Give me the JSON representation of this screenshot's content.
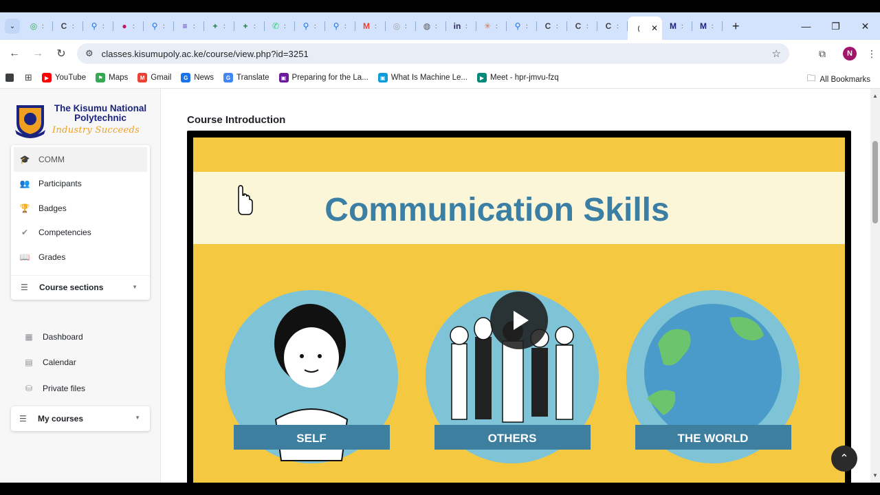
{
  "browser": {
    "tab_search_icon": "chevron-down-icon",
    "tabs": [
      {
        "icon": "google-lens-icon",
        "color": "#34a853",
        "glyph": "◎"
      },
      {
        "icon": "loading-c-icon",
        "color": "#444444",
        "glyph": "C"
      },
      {
        "icon": "search-icon",
        "color": "#1a73e8",
        "glyph": "⚲"
      },
      {
        "icon": "profile-icon",
        "color": "#c2185b",
        "glyph": "●"
      },
      {
        "icon": "search-icon",
        "color": "#1a73e8",
        "glyph": "⚲"
      },
      {
        "icon": "forms-icon",
        "color": "#5e35b1",
        "glyph": "≡"
      },
      {
        "icon": "sheets-icon",
        "color": "#188038",
        "glyph": "+"
      },
      {
        "icon": "sheets-icon",
        "color": "#188038",
        "glyph": "+"
      },
      {
        "icon": "whatsapp-icon",
        "color": "#25d366",
        "glyph": "✆"
      },
      {
        "icon": "search-icon",
        "color": "#1a73e8",
        "glyph": "⚲"
      },
      {
        "icon": "search-icon",
        "color": "#1a73e8",
        "glyph": "⚲"
      },
      {
        "icon": "gmail-icon",
        "color": "#ea4335",
        "glyph": "M"
      },
      {
        "icon": "spiral-icon",
        "color": "#9e9e9e",
        "glyph": "◎"
      },
      {
        "icon": "globe-icon",
        "color": "#555555",
        "glyph": "◍"
      },
      {
        "icon": "indeed-icon",
        "color": "#2d2d5f",
        "glyph": "in"
      },
      {
        "icon": "claude-icon",
        "color": "#d9774a",
        "glyph": "✳"
      },
      {
        "icon": "search-icon",
        "color": "#1a73e8",
        "glyph": "⚲"
      },
      {
        "icon": "loading-c-icon",
        "color": "#444444",
        "glyph": "C"
      },
      {
        "icon": "loading-c-icon",
        "color": "#444444",
        "glyph": "C"
      },
      {
        "icon": "loading-c-icon",
        "color": "#444444",
        "glyph": "C"
      }
    ],
    "active_tab_close": "✕",
    "extra_tabs": [
      {
        "icon": "moodle-m-icon",
        "color": "#1a237e",
        "glyph": "M"
      },
      {
        "icon": "moodle-m-icon",
        "color": "#1a237e",
        "glyph": "M"
      }
    ],
    "new_tab": "+",
    "window_controls": [
      "—",
      "❐",
      "✕"
    ],
    "url": "classes.kisumupoly.ac.ke/course/view.php?id=3251",
    "profile_initial": "N",
    "bookmarks": [
      {
        "label": "YouTube",
        "color": "#ff0000",
        "glyph": "▶"
      },
      {
        "label": "Maps",
        "color": "#34a853",
        "glyph": "⚑"
      },
      {
        "label": "Gmail",
        "color": "#ea4335",
        "glyph": "M"
      },
      {
        "label": "News",
        "color": "#1a73e8",
        "glyph": "G"
      },
      {
        "label": "Translate",
        "color": "#4285f4",
        "glyph": "G"
      },
      {
        "label": "Preparing for the La...",
        "color": "#6a1b9a",
        "glyph": "▣"
      },
      {
        "label": "What Is Machine Le...",
        "color": "#0f9bd7",
        "glyph": "▣"
      },
      {
        "label": "Meet - hpr-jmvu-fzq",
        "color": "#00897b",
        "glyph": "▶"
      }
    ],
    "all_bookmarks": "All Bookmarks"
  },
  "site": {
    "logo_name_line1": "The Kisumu National",
    "logo_name_line2": "Polytechnic",
    "logo_tagline": "Industry Succeeds"
  },
  "sidebar": {
    "course_items": [
      {
        "label": "COMM",
        "icon": "graduation-cap-icon",
        "glyph": "🎓"
      },
      {
        "label": "Participants",
        "icon": "users-icon",
        "glyph": "👥"
      },
      {
        "label": "Badges",
        "icon": "trophy-icon",
        "glyph": "🏆"
      },
      {
        "label": "Competencies",
        "icon": "check-icon",
        "glyph": "✔"
      },
      {
        "label": "Grades",
        "icon": "book-icon",
        "glyph": "📖"
      }
    ],
    "course_sections_label": "Course sections",
    "site_items": [
      {
        "label": "Dashboard",
        "icon": "dashboard-icon",
        "glyph": "▦"
      },
      {
        "label": "Calendar",
        "icon": "calendar-icon",
        "glyph": "▤"
      },
      {
        "label": "Private files",
        "icon": "files-icon",
        "glyph": "⛁"
      }
    ],
    "my_courses_label": "My courses"
  },
  "main": {
    "section_title": "Course Introduction",
    "video": {
      "title": "Communication Skills",
      "panels": [
        "SELF",
        "OTHERS",
        "THE WORLD"
      ],
      "colors": {
        "yellow": "#f5c842",
        "banner": "#fbf6d8",
        "title": "#3b7fa5",
        "circle": "#7ec4d6",
        "label_bg": "#3e7fa0",
        "globe": "#4a9bc9",
        "land": "#6cc46c"
      }
    }
  }
}
